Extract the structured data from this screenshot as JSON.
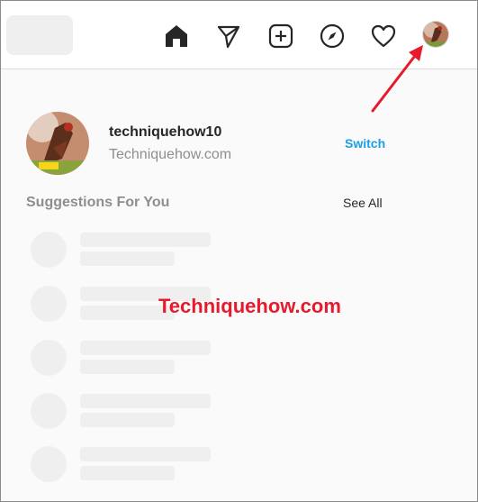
{
  "profile": {
    "username": "techniquehow10",
    "full_name": "Techniquehow.com",
    "switch_label": "Switch"
  },
  "suggestions": {
    "title": "Suggestions For You",
    "see_all_label": "See All",
    "placeholder_rows": 5
  },
  "nav": [
    "home-icon",
    "direct-icon",
    "new-post-icon",
    "explore-icon",
    "activity-icon",
    "profile-avatar"
  ],
  "watermark": "Techniquehow.com",
  "colors": {
    "link": "#1aa0e6",
    "watermark": "#e8192c",
    "arrow": "#e8192c",
    "skeleton": "#efefef"
  }
}
